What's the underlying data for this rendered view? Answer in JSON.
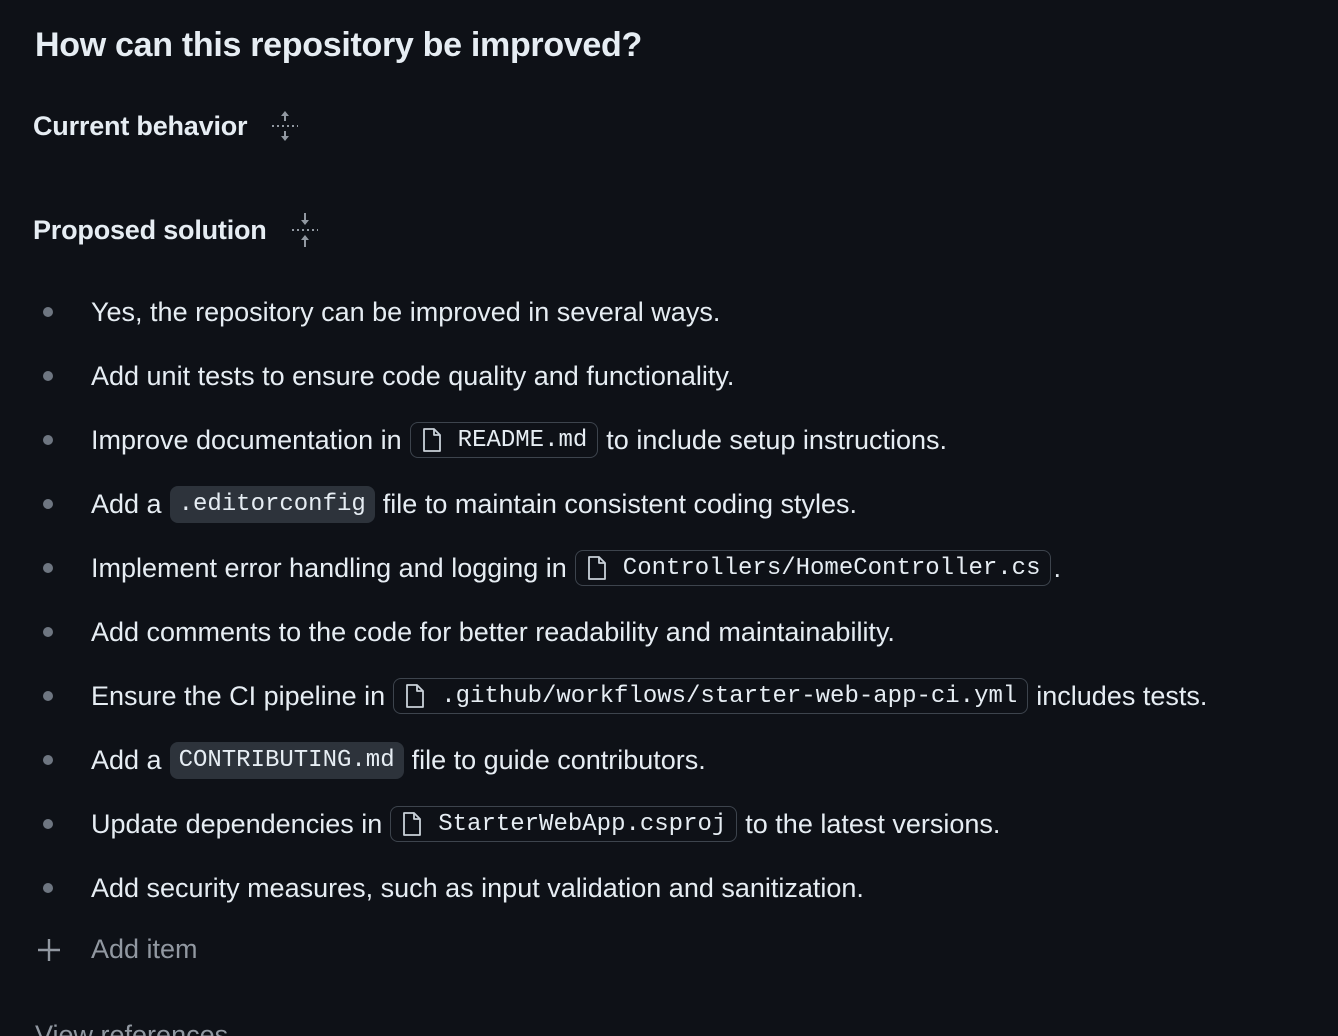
{
  "title": "How can this repository be improved?",
  "sections": {
    "current": {
      "label": "Current behavior",
      "icon": "expand-vertical-icon"
    },
    "proposed": {
      "label": "Proposed solution",
      "icon": "collapse-vertical-icon"
    }
  },
  "items": [
    {
      "segments": [
        {
          "type": "text",
          "value": "Yes, the repository can be improved in several ways."
        }
      ]
    },
    {
      "segments": [
        {
          "type": "text",
          "value": "Add unit tests to ensure code quality and functionality."
        }
      ]
    },
    {
      "segments": [
        {
          "type": "text",
          "value": "Improve documentation in"
        },
        {
          "type": "file",
          "value": "README.md"
        },
        {
          "type": "text",
          "value": "to include setup instructions."
        }
      ]
    },
    {
      "segments": [
        {
          "type": "text",
          "value": "Add a"
        },
        {
          "type": "code",
          "value": ".editorconfig"
        },
        {
          "type": "text",
          "value": "file to maintain consistent coding styles."
        }
      ]
    },
    {
      "segments": [
        {
          "type": "text",
          "value": "Implement error handling and logging in"
        },
        {
          "type": "file",
          "value": "Controllers/HomeController.cs"
        },
        {
          "type": "text",
          "value": "."
        }
      ]
    },
    {
      "segments": [
        {
          "type": "text",
          "value": "Add comments to the code for better readability and maintainability."
        }
      ]
    },
    {
      "segments": [
        {
          "type": "text",
          "value": "Ensure the CI pipeline in"
        },
        {
          "type": "file",
          "value": ".github/workflows/starter-web-app-ci.yml"
        },
        {
          "type": "text",
          "value": "includes tests."
        }
      ]
    },
    {
      "segments": [
        {
          "type": "text",
          "value": "Add a"
        },
        {
          "type": "code",
          "value": "CONTRIBUTING.md"
        },
        {
          "type": "text",
          "value": "file to guide contributors."
        }
      ]
    },
    {
      "segments": [
        {
          "type": "text",
          "value": "Update dependencies in"
        },
        {
          "type": "file",
          "value": "StarterWebApp.csproj"
        },
        {
          "type": "text",
          "value": "to the latest versions."
        }
      ]
    },
    {
      "segments": [
        {
          "type": "text",
          "value": "Add security measures, such as input validation and sanitization."
        }
      ]
    }
  ],
  "add_item": {
    "label": "Add item",
    "icon": "plus-icon"
  },
  "view_references": {
    "label": "View references"
  },
  "colors": {
    "background": "#0e1117",
    "text": "#e6edf3",
    "muted": "#9198a1",
    "bullet": "#6e7681",
    "chip_bg": "#2d333b",
    "chip_border": "#3d444d"
  }
}
